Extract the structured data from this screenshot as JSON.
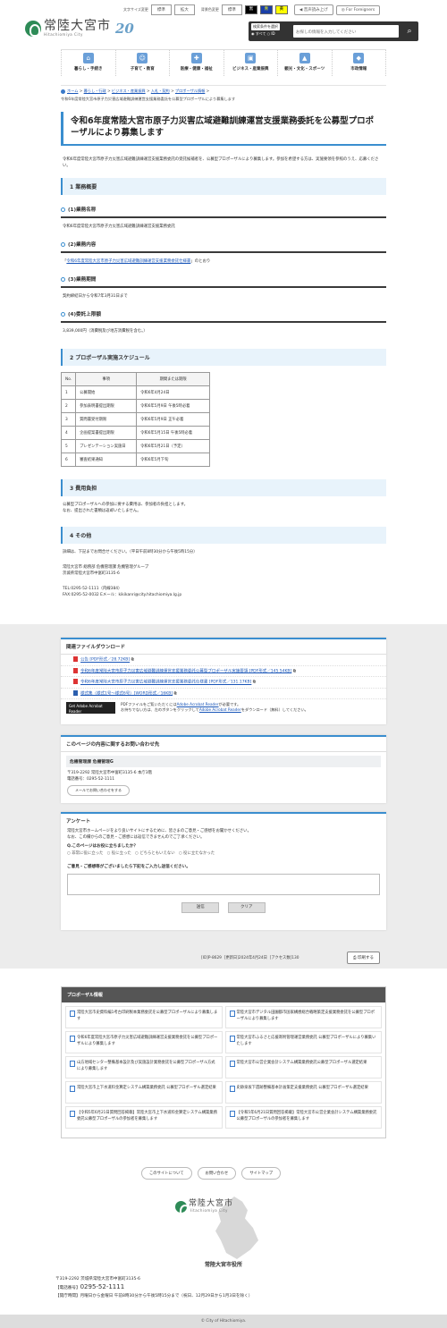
{
  "header": {
    "logo_name": "常陸大宮市",
    "logo_sub": "Hitachiomiya City",
    "logo_badge": "20",
    "font_size_label": "文字サイズ変更",
    "font_standard": "標準",
    "font_large": "拡大",
    "color_label": "背景色変更",
    "color_standard": "標準",
    "color_black": "黒",
    "color_blue": "青",
    "color_yellow": "黄",
    "voice_read": "音声読み上げ",
    "foreigners": "For Foreigners",
    "search_label": "検索条件を選択",
    "search_opt_all": "すべて",
    "search_opt_id": "ID",
    "search_placeholder": "お探しの情報を入力してください"
  },
  "gnav": [
    {
      "label": "暮らし・手続き",
      "icon": "home-icon"
    },
    {
      "label": "子育て・教育",
      "icon": "child-icon"
    },
    {
      "label": "医療・健康・福祉",
      "icon": "medical-icon"
    },
    {
      "label": "ビジネス・産業振興",
      "icon": "business-icon"
    },
    {
      "label": "観光・文化・スポーツ",
      "icon": "tourism-icon"
    },
    {
      "label": "市政情報",
      "icon": "cityhall-icon"
    }
  ],
  "breadcrumb": {
    "items": [
      "ホーム",
      "暮らし・行政",
      "ビジネス・産業振興",
      "入札・契約",
      "プロポーザル情報"
    ],
    "current": "令和6年度常陸大宮市原子力災害広域避難訓練運営支援業務委託を公募型プロポーザルにより募集します"
  },
  "page": {
    "title": "令和6年度常陸大宮市原子力災害広域避難訓練運営支援業務委託を公募型プロポーザルにより募集します",
    "intro": "令和6年度常陸大宮市原子力災害広域避難訓練運営支援業務委託の受託候補者を、公募型プロポーザルにより募集します。参加を希望する方は、実施要領を参照のうえ、応募ください。",
    "sec1_title": "1 業務概要",
    "sec1_1_title": "(1)業務名称",
    "sec1_1_text": "令和6年度常陸大宮市原子力災害広域避難訓練運営支援業務委託",
    "sec1_2_title": "(2)業務内容",
    "sec1_2_pre": "「",
    "sec1_2_link": "令和6年度常陸大宮市原子力災害広域避難訓練運営支援業務委託仕様書",
    "sec1_2_post": "」のとおり",
    "sec1_3_title": "(3)業務期間",
    "sec1_3_text": "契約締結日から令和7年3月31日まで",
    "sec1_4_title": "(4)委託上限額",
    "sec1_4_text": "3,839,000円（消費税及び地方消費税を含む。）",
    "sec2_title": "2 プロポーザル実施スケジュール",
    "sched_headers": [
      "No.",
      "事項",
      "期間または期限"
    ],
    "sched_rows": [
      [
        "1",
        "公募開始",
        "令和6年4月24日"
      ],
      [
        "2",
        "参加表明書提出期限",
        "令和6年5月9日 午後5時必着"
      ],
      [
        "3",
        "質問書受付期限",
        "令和6年5月9日 正午必着"
      ],
      [
        "4",
        "企画提案書提出期限",
        "令和6年5月15日 午後5時必着"
      ],
      [
        "5",
        "プレゼンテーション実施日",
        "令和6年5月21日（予定）"
      ],
      [
        "6",
        "審査結果通知",
        "令和6年5月下旬"
      ]
    ],
    "sec3_title": "3 費用負担",
    "sec3_text1": "公募型プロポーザルへの参加に要する費用は、参加者の負担とします。",
    "sec3_text2": "なお、提出された書類は返却いたしません。",
    "sec4_title": "4 その他",
    "sec4_text": "詳細は、下記までお問合せください。（平日午前8時30分から午後5時15分）",
    "contact1": "常陸大宮市 総務部 危機管理課 危機管理グループ",
    "contact2": "茨城県常陸大宮市中富町3135-6",
    "contact3": "TEL:0295-52-1111（内線384）",
    "contact4": "FAX:0295-52-0032 Eメール：kikikanri@city.hitachiomiya.lg.jp"
  },
  "downloads": {
    "title": "関連ファイルダウンロード",
    "files": [
      {
        "label": "公告 [PDF形式／28.72KB]",
        "type": "pdf"
      },
      {
        "label": "令和6年度常陸大宮市原子力災害広域避難訓練運営支援業務委託公募型プロポーザル実施要領 [PDF形式／145.54KB]",
        "type": "pdf"
      },
      {
        "label": "令和6年度常陸大宮市原子力災害広域避難訓練運営支援業務委託仕様書 [PDF形式／131.17KB]",
        "type": "pdf"
      },
      {
        "label": "様式集（様式1号～様式6号）[WORD形式／16KB]",
        "type": "doc"
      }
    ],
    "adobe_badge": "Get Adobe Acrobat Reader",
    "adobe_text1_pre": "PDFファイルをご覧いただくには",
    "adobe_link": "Adobe Acrobat Reader",
    "adobe_text1_post": "が必要です。",
    "adobe_text2_pre": "お持ちでない方は、左のボタンをクリックして",
    "adobe_link2": "Adobe Acrobat Reader",
    "adobe_text2_post": "をダウンロード（無料）してください。"
  },
  "contact_box": {
    "title": "このページの内容に関するお問い合わせ先",
    "dept": "危機管理課 危機管理G",
    "address": "〒319-2292 常陸大宮市中富町3135-6 本庁3階",
    "tel": "電話番号：0295-52-1111",
    "mail_button": "メールでお問い合わせをする"
  },
  "survey": {
    "title": "アンケート",
    "text1": "常陸大宮市ホームページをより良いサイトにするために、皆さまのご意見・ご感想をお聞かせください。",
    "text2": "なお、この欄からのご意見・ご感想には返信できませんのでご了承ください。",
    "question": "Q.このページはお役に立ちましたか？",
    "options": [
      "非常に役に立った",
      "役に立った",
      "どちらともいえない",
      "役に立たなかった"
    ],
    "comment_label": "ご意見・ご感想等がございましたら下記をご入力し送信ください。",
    "submit": "送信",
    "clear": "クリア"
  },
  "meta": {
    "id": "[ID]P-8629",
    "updated": "[更新日]2024年4月24日",
    "access": "[アクセス数]130",
    "print": "印刷する"
  },
  "proposal": {
    "title": "プロポーザル情報",
    "items": [
      "常陸大宮市史資料編1考古印刷製本業務委託を公募型プロポーザルにより募集します",
      "常陸大宮市デジタル田園都市国家構想総合戦略策定支援業務委託を公募型プロポーザルにより募集します",
      "令和6年度常陸大宮市原子力災害広域避難訓練運営支援業務委託を公募型プロポーザルにより募集します",
      "常陸大宮市ふるさと応援寄附管理運営業務委託 公募型プロポーザルにより募集いたします",
      "山方地域センター整備基本設計及び実施設計業務委託を公募型プロポーザル方式により募集します",
      "常陸大宮市公営企業会計システム構築業務委託公募型プロポーザル選定結果",
      "常陸大宮市上下水道料金算定システム構築業務委託 公募型プロポーザル選定結果",
      "史跡泉坂下遺跡整備基本計画策定支援業務委託 公募型プロポーザル選定結果",
      "【令和5年6月21日質問回答掲載】常陸大宮市上下水道料金算定システム構築業務委託公募型プロポーザルの参加者を募集します",
      "【令和5年6月21日質問回答掲載】常陸大宮市公営企業会計システム構築業務委託公募型プロポーザルの参加者を募集します"
    ]
  },
  "footer": {
    "nav": [
      "このサイトについて",
      "お問い合わせ",
      "サイトマップ"
    ],
    "logo_name": "常陸大宮市",
    "logo_sub": "Hitachiomiya City",
    "office": "常陸大宮市役所",
    "address": "〒319-2292 茨城県常陸大宮市中富町3135-6",
    "tel_label": "【電話番号】",
    "tel": "0295-52-1111",
    "hours": "【開庁時間】月曜日から金曜日 午前8時30分から午後5時15分まで（祝日、12月29日から1月3日を除く）",
    "copyright": "© City of Hitachiomiya."
  }
}
